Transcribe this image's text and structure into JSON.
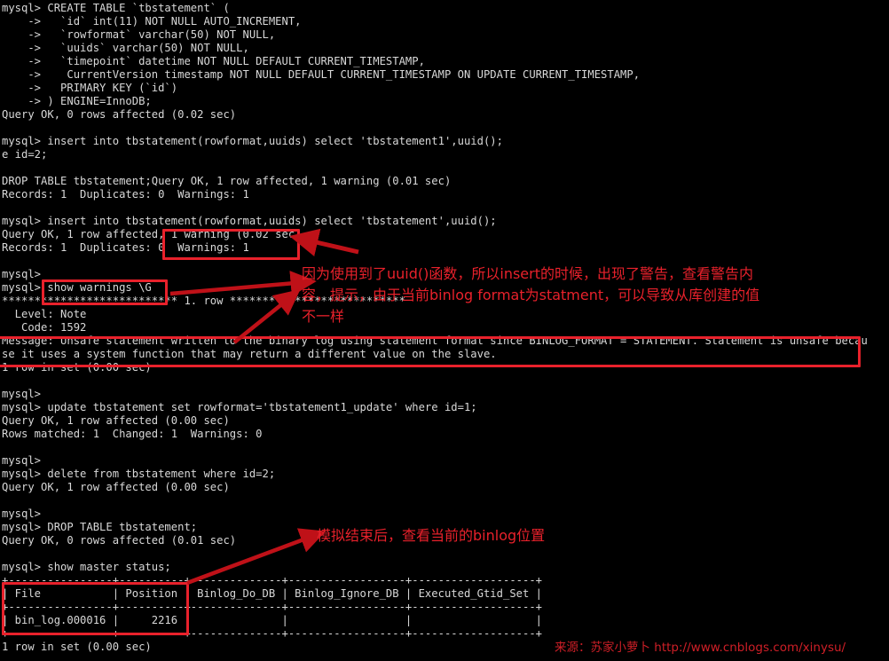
{
  "terminal": {
    "prompt": "mysql>",
    "foreground_color": "#d8d8d8",
    "background_color": "#000000",
    "lines": [
      "mysql> CREATE TABLE `tbstatement` (",
      "    ->   `id` int(11) NOT NULL AUTO_INCREMENT,",
      "    ->   `rowformat` varchar(50) NOT NULL,",
      "    ->   `uuids` varchar(50) NOT NULL,",
      "    ->   `timepoint` datetime NOT NULL DEFAULT CURRENT_TIMESTAMP,",
      "    ->    CurrentVersion timestamp NOT NULL DEFAULT CURRENT_TIMESTAMP ON UPDATE CURRENT_TIMESTAMP,",
      "    ->   PRIMARY KEY (`id`)",
      "    -> ) ENGINE=InnoDB;",
      "Query OK, 0 rows affected (0.02 sec)",
      "",
      "mysql> insert into tbstatement(rowformat,uuids) select 'tbstatement1',uuid();",
      "e id=2;",
      "",
      "DROP TABLE tbstatement;Query OK, 1 row affected, 1 warning (0.01 sec)",
      "Records: 1  Duplicates: 0  Warnings: 1",
      "",
      "mysql> insert into tbstatement(rowformat,uuids) select 'tbstatement',uuid();",
      "Query OK, 1 row affected, 1 warning (0.02 sec)",
      "Records: 1  Duplicates: 0  Warnings: 1",
      "",
      "mysql>",
      "mysql> show warnings \\G",
      "*************************** 1. row ***************************",
      "  Level: Note",
      "   Code: 1592",
      "Message: Unsafe statement written to the binary log using statement format since BINLOG_FORMAT = STATEMENT. Statement is unsafe becau",
      "se it uses a system function that may return a different value on the slave.",
      "1 row in set (0.00 sec)",
      "",
      "mysql>",
      "mysql> update tbstatement set rowformat='tbstatement1_update' where id=1;",
      "Query OK, 1 row affected (0.00 sec)",
      "Rows matched: 1  Changed: 1  Warnings: 0",
      "",
      "mysql>",
      "mysql> delete from tbstatement where id=2;",
      "Query OK, 1 row affected (0.00 sec)",
      "",
      "mysql>",
      "mysql> DROP TABLE tbstatement;",
      "Query OK, 0 rows affected (0.01 sec)",
      "",
      "mysql> show master status;",
      "+----------------+----------+--------------+------------------+-------------------+",
      "| File           | Position | Binlog_Do_DB | Binlog_Ignore_DB | Executed_Gtid_Set |",
      "+----------------+----------+--------------+------------------+-------------------+",
      "| bin_log.000016 |     2216 |              |                  |                   |",
      "+----------------+----------+--------------+------------------+-------------------+",
      "1 row in set (0.00 sec)"
    ]
  },
  "master_status_table": {
    "columns": [
      "File",
      "Position",
      "Binlog_Do_DB",
      "Binlog_Ignore_DB",
      "Executed_Gtid_Set"
    ],
    "rows": [
      [
        "bin_log.000016",
        "2216",
        "",
        "",
        ""
      ]
    ],
    "result_footer": "1 row in set (0.00 sec)"
  },
  "warning_detail": {
    "level_label": "Level:",
    "level_value": "Note",
    "code_label": "Code:",
    "code_value": "1592",
    "message_label": "Message:",
    "message_value": "Unsafe statement written to the binary log using statement format since BINLOG_FORMAT = STATEMENT. Statement is unsafe because it uses a system function that may return a different value on the slave."
  },
  "annotations": {
    "color": "#e8212b",
    "note_warning": "因为使用到了uuid()函数，所以insert的时候，出现了警告，查看警告内\n容，提示，由于当前binlog format为statment，可以导致从库创建的值\n不一样",
    "note_binlog_position": "模拟结束后，查看当前的binlog位置",
    "boxes": [
      {
        "name": "warning-count-box",
        "label": "1 warning (0.02 sec) / Warnings: 1"
      },
      {
        "name": "show-warnings-command-box",
        "label": "show warnings \\G"
      },
      {
        "name": "unsafe-message-box",
        "label": "Message: Unsafe statement ..."
      },
      {
        "name": "master-status-file-position-box",
        "label": "File | Position"
      }
    ]
  },
  "watermark": {
    "text": "来源：苏家小萝卜 http://www.cnblogs.com/xinysu/",
    "color": "#cf1f27"
  }
}
